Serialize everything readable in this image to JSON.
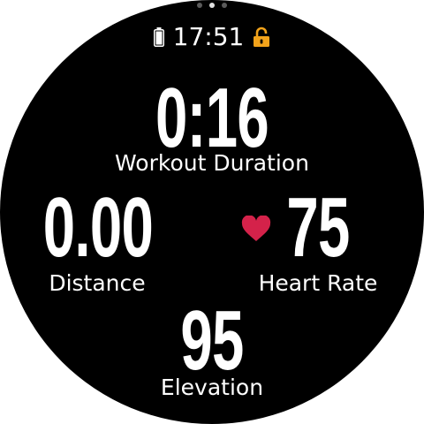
{
  "status": {
    "time": "17:51",
    "battery_icon": "battery-icon",
    "lock_icon": "lock-icon",
    "lock_color": "#f2a31b"
  },
  "pager": {
    "count": 3,
    "active_index": 1
  },
  "metrics": {
    "workout_duration": {
      "value": "0:16",
      "label": "Workout Duration"
    },
    "distance": {
      "value": "0.00",
      "label": "Distance"
    },
    "heart_rate": {
      "value": "75",
      "label": "Heart Rate",
      "icon": "heart-icon",
      "icon_color": "#d4224a"
    },
    "elevation": {
      "value": "95",
      "label": "Elevation"
    }
  }
}
